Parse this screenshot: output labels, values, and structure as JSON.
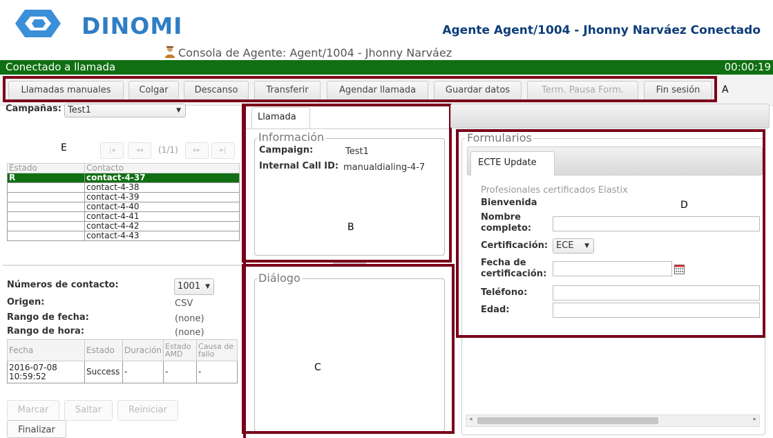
{
  "header": {
    "logo_text": "DINOMI",
    "agent_title": "Agente Agent/1004 - Jhonny Narváez Conectado",
    "console_title": "Consola de Agente: Agent/1004 - Jhonny Narváez"
  },
  "status": {
    "text": "Conectado a llamada",
    "timer": "00:00:19",
    "color": "#0f6f12"
  },
  "toolbar": {
    "manual_calls": "Llamadas manuales",
    "hangup": "Colgar",
    "break": "Descanso",
    "transfer": "Transferir",
    "schedule": "Agendar llamada",
    "save": "Guardar datos",
    "end_pause": "Term. Pausa Form.",
    "logout": "Fin sesión"
  },
  "annotations": {
    "a": "A",
    "b": "B",
    "c": "C",
    "d": "D",
    "e": "E",
    "color": "#7a0019"
  },
  "left": {
    "campaign_label": "Campañas:",
    "campaign_value": "Test1",
    "pager_text": "(1/1)",
    "table_headers": [
      "Estado",
      "Contacto"
    ],
    "rows": [
      {
        "estado": "R",
        "contacto": "contact-4-37"
      },
      {
        "estado": "",
        "contacto": "contact-4-38"
      },
      {
        "estado": "",
        "contacto": "contact-4-39"
      },
      {
        "estado": "",
        "contacto": "contact-4-40"
      },
      {
        "estado": "",
        "contacto": "contact-4-41"
      },
      {
        "estado": "",
        "contacto": "contact-4-42"
      },
      {
        "estado": "",
        "contacto": "contact-4-43"
      }
    ],
    "numbers_label": "Números de contacto:",
    "numbers_value": "1001",
    "origin_label": "Origen:",
    "origin_value": "CSV",
    "date_range_label": "Rango de fecha:",
    "date_range_value": "(none)",
    "hour_range_label": "Rango de hora:",
    "hour_range_value": "(none)",
    "history_headers": [
      "Fecha",
      "Estado",
      "Duración",
      "Estado AMD",
      "Causa de fallo"
    ],
    "history_row": {
      "fecha": "2016-07-08 10:59:52",
      "estado": "Success",
      "duracion": "-",
      "amd": "-",
      "causa": "-"
    },
    "btn_dial": "Marcar",
    "btn_skip": "Saltar",
    "btn_restart": "Reiniciar",
    "btn_finish": "Finalizar"
  },
  "call": {
    "tab_label": "Llamada",
    "info_title": "Información",
    "campaign_label": "Campaign:",
    "campaign_value": "Test1",
    "callid_label": "Internal Call ID:",
    "callid_value": "manualdialing-4-7",
    "dialog_title": "Diálogo"
  },
  "forms": {
    "title": "Formularios",
    "tab_label": "ECTE Update",
    "subtitle": "Profesionales certificados Elastix",
    "welcome": "Bienvenida",
    "name_label": "Nombre completo:",
    "cert_label": "Certificación:",
    "cert_value": "ECE",
    "cert_date_label": "Fecha de certificación:",
    "phone_label": "Teléfono:",
    "age_label": "Edad:"
  }
}
